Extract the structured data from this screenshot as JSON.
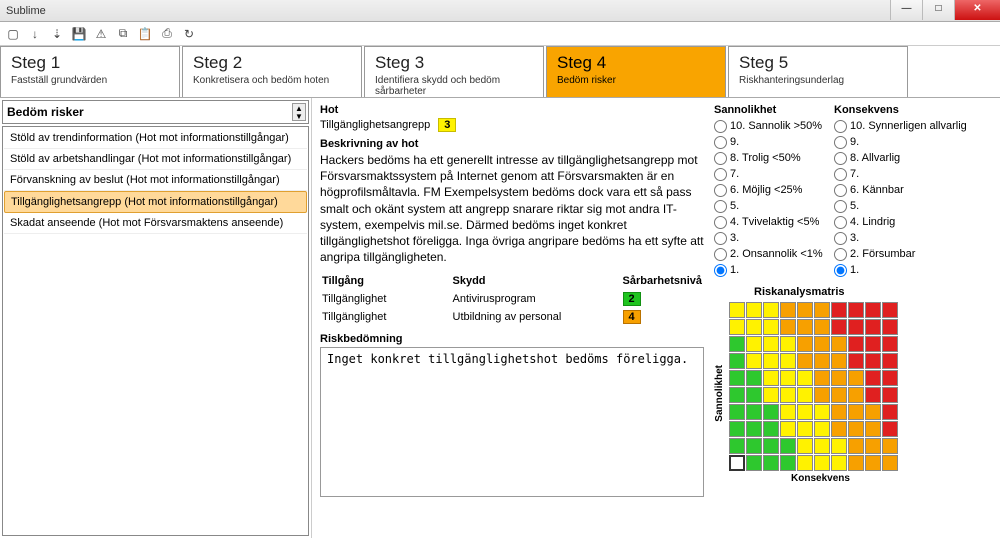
{
  "window": {
    "title": "Sublime"
  },
  "toolbar_icons": [
    "new",
    "open",
    "down",
    "save",
    "save-warn",
    "copy",
    "paste",
    "print",
    "refresh"
  ],
  "steps": [
    {
      "title": "Steg 1",
      "sub": "Fastställ grundvärden"
    },
    {
      "title": "Steg 2",
      "sub": "Konkretisera och bedöm hoten"
    },
    {
      "title": "Steg 3",
      "sub": "Identifiera skydd och bedöm sårbarheter"
    },
    {
      "title": "Steg 4",
      "sub": "Bedöm risker"
    },
    {
      "title": "Steg 5",
      "sub": "Riskhanteringsunderlag"
    }
  ],
  "active_step": 3,
  "combo_label": "Bedöm risker",
  "list": [
    "Stöld av trendinformation (Hot mot informationstillgångar)",
    "Stöld av arbetshandlingar (Hot mot informationstillgångar)",
    "Förvanskning av beslut (Hot mot informationstillgångar)",
    "Tillgänglighetsangrepp (Hot mot informationstillgångar)",
    "Skadat anseende (Hot mot Försvarsmaktens anseende)"
  ],
  "selected_list_index": 3,
  "hot": {
    "heading": "Hot",
    "name": "Tillgänglighetsangrepp",
    "level": "3"
  },
  "beskrivning_heading": "Beskrivning av hot",
  "beskrivning": "Hackers bedöms ha ett generellt intresse av tillgänglighetsangrepp mot Försvarsmaktssystem på Internet genom att Försvarsmakten är en högprofilsmåltavla. FM Exempelsystem bedöms dock vara ett så pass smalt och okänt system att angrepp snarare riktar sig mot andra IT-system, exempelvis mil.se. Därmed bedöms inget konkret tillgänglighetshot föreligga. Inga övriga angripare bedöms ha ett syfte att angripa tillgängligheten.",
  "table": {
    "h_tillgang": "Tillgång",
    "h_skydd": "Skydd",
    "h_sarb": "Sårbarhetsnivå",
    "rows": [
      {
        "tillgang": "Tillgänglighet",
        "skydd": "Antivirusprogram",
        "level": "2",
        "cls": "b-green"
      },
      {
        "tillgang": "Tillgänglighet",
        "skydd": "Utbildning av personal",
        "level": "4",
        "cls": "b-orange"
      }
    ]
  },
  "riskbed_heading": "Riskbedömning",
  "riskbed_text": "Inget konkret tillgänglighetshot bedöms föreligga.",
  "sannolikhet_heading": "Sannolikhet",
  "konsekvens_heading": "Konsekvens",
  "sannolikhet": [
    "10. Sannolik >50%",
    "9.",
    "8. Trolig <50%",
    "7.",
    "6. Möjlig <25%",
    "5.",
    "4. Tvivelaktig <5%",
    "3.",
    "2. Onsannolik <1%",
    "1."
  ],
  "konsekvens": [
    "10. Synnerligen allvarlig",
    "9.",
    "8. Allvarlig",
    "7.",
    "6. Kännbar",
    "5.",
    "4. Lindrig",
    "3.",
    "2. Försumbar",
    "1."
  ],
  "sannolikhet_selected": 9,
  "konsekvens_selected": 9,
  "matrix_title": "Riskanalysmatris",
  "matrix_ylabel": "Sannolikhet",
  "matrix_xlabel": "Konsekvens",
  "matrix": [
    [
      "y",
      "y",
      "y",
      "o",
      "o",
      "o",
      "r",
      "r",
      "r",
      "r"
    ],
    [
      "y",
      "y",
      "y",
      "o",
      "o",
      "o",
      "r",
      "r",
      "r",
      "r"
    ],
    [
      "g",
      "y",
      "y",
      "y",
      "o",
      "o",
      "o",
      "r",
      "r",
      "r"
    ],
    [
      "g",
      "y",
      "y",
      "y",
      "o",
      "o",
      "o",
      "r",
      "r",
      "r"
    ],
    [
      "g",
      "g",
      "y",
      "y",
      "y",
      "o",
      "o",
      "o",
      "r",
      "r"
    ],
    [
      "g",
      "g",
      "y",
      "y",
      "y",
      "o",
      "o",
      "o",
      "r",
      "r"
    ],
    [
      "g",
      "g",
      "g",
      "y",
      "y",
      "y",
      "o",
      "o",
      "o",
      "r"
    ],
    [
      "g",
      "g",
      "g",
      "y",
      "y",
      "y",
      "o",
      "o",
      "o",
      "r"
    ],
    [
      "g",
      "g",
      "g",
      "g",
      "y",
      "y",
      "y",
      "o",
      "o",
      "o"
    ],
    [
      "w",
      "g",
      "g",
      "g",
      "y",
      "y",
      "y",
      "o",
      "o",
      "o"
    ]
  ]
}
